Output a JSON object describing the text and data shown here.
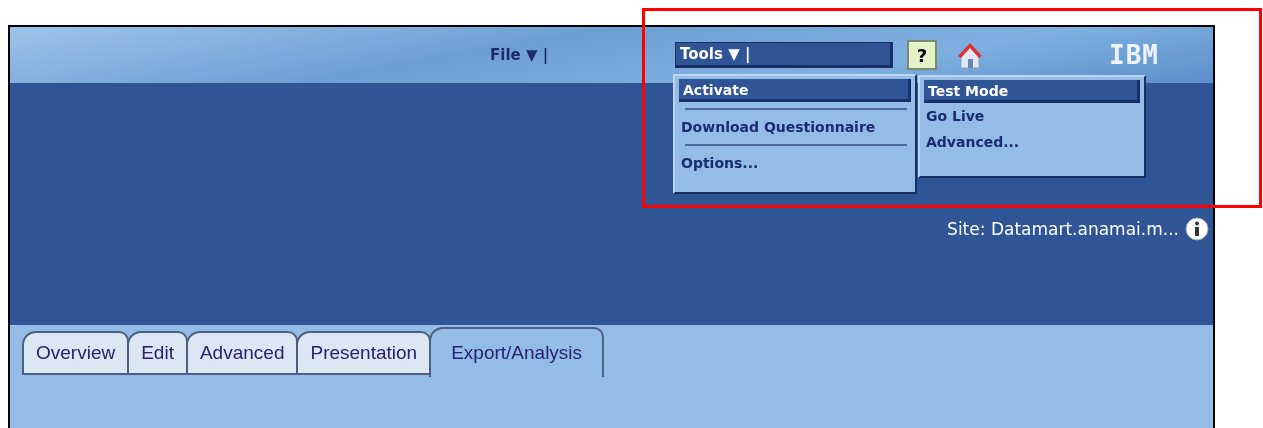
{
  "header": {
    "file_menu": {
      "label": "File",
      "arrow": "▼",
      "separator": "|"
    },
    "tools_menu": {
      "label": "Tools",
      "arrow": "▼",
      "separator": "|"
    },
    "help_button": {
      "label": "?"
    },
    "logo": "IBM"
  },
  "tools_dropdown": {
    "items": [
      {
        "label": "Activate",
        "selected": true
      },
      {
        "label": "Download Questionnaire",
        "selected": false
      },
      {
        "label": "Options...",
        "selected": false
      }
    ]
  },
  "activate_submenu": {
    "items": [
      {
        "label": "Test Mode",
        "selected": true
      },
      {
        "label": "Go Live",
        "selected": false
      },
      {
        "label": "Advanced...",
        "selected": false
      }
    ]
  },
  "site": "Site: Datamart.anamai.m...",
  "tabs": [
    {
      "label": "Overview",
      "selected": false
    },
    {
      "label": "Edit",
      "selected": false
    },
    {
      "label": "Advanced",
      "selected": false
    },
    {
      "label": "Presentation",
      "selected": false
    },
    {
      "label": "Export/Analysis",
      "selected": true
    }
  ],
  "highlight": true
}
